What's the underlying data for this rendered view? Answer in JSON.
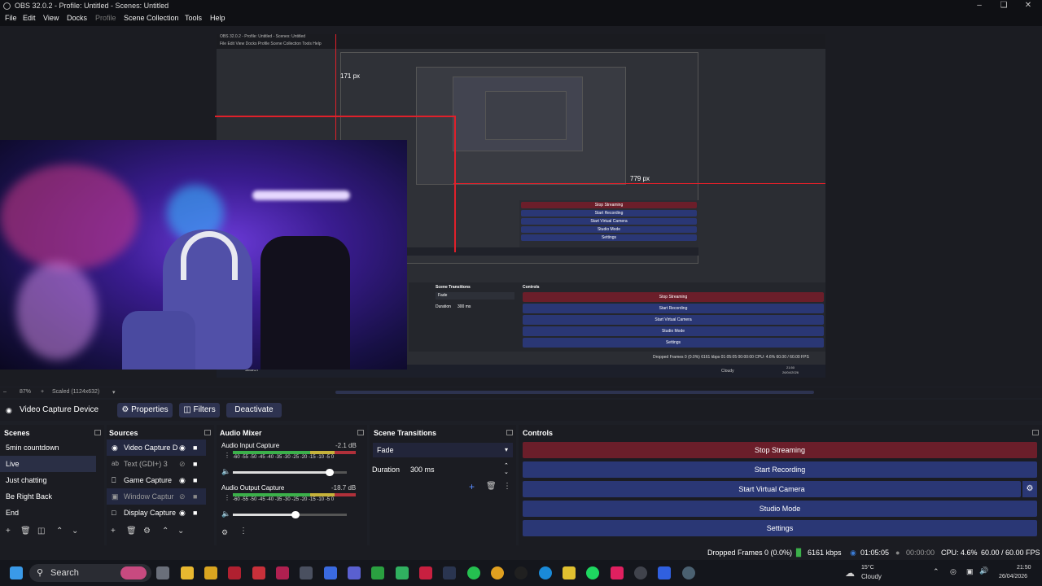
{
  "window": {
    "title": "OBS 32.0.2 - Profile: Untitled - Scenes: Untitled"
  },
  "menu": [
    "File",
    "Edit",
    "View",
    "Docks",
    "Profile",
    "Scene Collection",
    "Tools",
    "Help"
  ],
  "preview": {
    "inner_title": "OBS 32.0.2 - Profile: Untitled - Scenes: Untitled",
    "inner_menu": "File  Edit  View  Docks  Profile  Scene Collection  Tools  Help",
    "measure_vertical": "171 px",
    "measure_horizontal": "779 px",
    "inner_measure_v": "171 px",
    "inner_measure_h": "779 px",
    "inner_scene_transitions": "Scene Transitions",
    "inner_controls": "Controls",
    "inner_fade": "Fade",
    "inner_duration": "Duration",
    "inner_duration_val": "300 ms",
    "inner_buttons": [
      "Stop Streaming",
      "Start Recording",
      "Start Virtual Camera",
      "Studio Mode",
      "Settings"
    ],
    "inner_status": "Dropped Frames 0 (0.0%)   6161 kbps   01:05:05   00:00:00   CPU: 4.6%   60.00 / 60.00 FPS",
    "inner_search": "Search",
    "inner_weather": "Cloudy",
    "inner_time": "21:50",
    "inner_date": "26/04/2026"
  },
  "zoom": {
    "percent": "87%",
    "scaled": "Scaled (1124x632)"
  },
  "source_toolbar": {
    "source": "Video Capture Device",
    "properties": "Properties",
    "filters": "Filters",
    "deactivate": "Deactivate"
  },
  "scenes": {
    "title": "Scenes",
    "items": [
      "5min countdown",
      "Live",
      "Just chatting",
      "Be Right Back",
      "End"
    ],
    "selected": "Live"
  },
  "sources": {
    "title": "Sources",
    "items": [
      {
        "label": "Video Capture D",
        "icon": "camera-icon",
        "hidden": false
      },
      {
        "label": "Text (GDI+) 3",
        "icon": "text-icon",
        "hidden": true
      },
      {
        "label": "Game Capture",
        "icon": "gamepad-icon",
        "hidden": false
      },
      {
        "label": "Window Captur",
        "icon": "window-icon",
        "hidden": true
      },
      {
        "label": "Display Capture",
        "icon": "monitor-icon",
        "hidden": false
      }
    ]
  },
  "audio_mixer": {
    "title": "Audio Mixer",
    "channels": [
      {
        "name": "Audio Input Capture",
        "db": "-2.1 dB",
        "volume": 0.85
      },
      {
        "name": "Audio Output Capture",
        "db": "-18.7 dB",
        "volume": 0.55
      }
    ],
    "scale": "-60 -55 -50 -45 -40 -35 -30 -25 -20 -15 -10 -5 0"
  },
  "transitions": {
    "title": "Scene Transitions",
    "selected": "Fade",
    "duration_label": "Duration",
    "duration_value": "300 ms"
  },
  "controls": {
    "title": "Controls",
    "buttons": [
      "Stop Streaming",
      "Start Recording",
      "Start Virtual Camera",
      "Studio Mode",
      "Settings"
    ]
  },
  "status": {
    "dropped": "Dropped Frames 0 (0.0%)",
    "bitrate": "6161 kbps",
    "stream_time": "01:05:05",
    "rec_time": "00:00:00",
    "cpu": "CPU: 4.6%",
    "fps": "60.00 / 60.00 FPS"
  },
  "taskbar": {
    "search": "Search",
    "temp": "15°C",
    "weather": "Cloudy",
    "time": "21:50",
    "date": "26/04/2026"
  },
  "colors": {
    "accent": "#2e3a7a",
    "stop_stream": "#6b1e2a",
    "control": "#2a3775",
    "red_guide": "#e0202a"
  }
}
